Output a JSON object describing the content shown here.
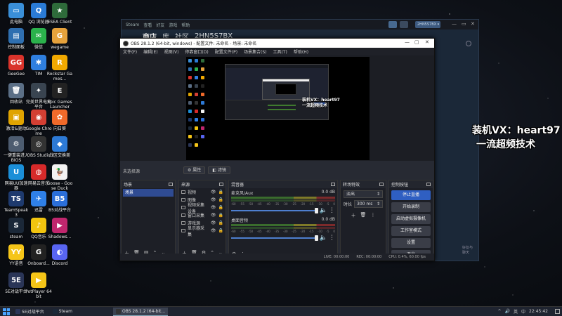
{
  "desktop": {
    "icons": [
      {
        "label": "此电脑",
        "color": "#3a8fd8",
        "glyph": "▭"
      },
      {
        "label": "QQ 浏览器",
        "color": "#2a7bd6",
        "glyph": "Q"
      },
      {
        "label": "ESEA Client",
        "color": "#2e6b3a",
        "glyph": "★"
      },
      {
        "label": "控制面板",
        "color": "#2f6fb0",
        "glyph": "▤"
      },
      {
        "label": "微信",
        "color": "#2bb24c",
        "glyph": "✉"
      },
      {
        "label": "wegame",
        "color": "#e6a23c",
        "glyph": "G"
      },
      {
        "label": "GeeGee",
        "color": "#d9332b",
        "glyph": "GG"
      },
      {
        "label": "TIM",
        "color": "#2f7fe0",
        "glyph": "✱"
      },
      {
        "label": "Rockstar Games...",
        "color": "#f2a900",
        "glyph": "R"
      },
      {
        "label": "回收站",
        "color": "#5b6f86",
        "glyph": "🗑"
      },
      {
        "label": "完美世界电竞平台",
        "color": "#394450",
        "glyph": "✦"
      },
      {
        "label": "Epic Games Launcher",
        "color": "#222",
        "glyph": "E"
      },
      {
        "label": "激活&驱动",
        "color": "#e0a400",
        "glyph": "▣"
      },
      {
        "label": "Google Chrome",
        "color": "#d33f33",
        "glyph": "◉"
      },
      {
        "label": "向日葵",
        "color": "#f06a2a",
        "glyph": "✿"
      },
      {
        "label": "一键重装进入BIOS",
        "color": "#4d5c70",
        "glyph": "⚙"
      },
      {
        "label": "OBS Studio",
        "color": "#333",
        "glyph": "◎"
      },
      {
        "label": "战区交换美",
        "color": "#2d7ad6",
        "glyph": "◆"
      },
      {
        "label": "网易UU加速器",
        "color": "#1b8fd8",
        "glyph": "U"
      },
      {
        "label": "网易云音乐",
        "color": "#d72a2a",
        "glyph": "◍"
      },
      {
        "label": "Goose - Goose Duck",
        "color": "#f2f2f2",
        "glyph": "🦆"
      },
      {
        "label": "TeamSpeak 3",
        "color": "#1e3a6e",
        "glyph": "TS"
      },
      {
        "label": "迅雷",
        "color": "#2f80e8",
        "glyph": "✈"
      },
      {
        "label": "B5对战平台",
        "color": "#2b6fd9",
        "glyph": "B5"
      },
      {
        "label": "steam",
        "color": "#1b2838",
        "glyph": "S"
      },
      {
        "label": "QQ音乐",
        "color": "#f1c40f",
        "glyph": "♪"
      },
      {
        "label": "Shadows...",
        "color": "#c0266d",
        "glyph": "▶"
      },
      {
        "label": "YY语音",
        "color": "#f5c518",
        "glyph": "YY"
      },
      {
        "label": "Onboard...",
        "color": "#222",
        "glyph": "G"
      },
      {
        "label": "Discord",
        "color": "#5865f2",
        "glyph": "◐"
      },
      {
        "label": "5E对战平台",
        "color": "#2a3557",
        "glyph": "5E"
      },
      {
        "label": "PotPlayer 64 bit",
        "color": "#f5c518",
        "glyph": "▶"
      }
    ]
  },
  "steam": {
    "menu": [
      "Steam",
      "查看",
      "好友",
      "游戏",
      "帮助"
    ],
    "nav": [
      "商店",
      "库",
      "社区",
      "2HN5S7BX"
    ],
    "user": "2HN5S7BX ▾",
    "footer": [
      "好友与",
      "聊天"
    ]
  },
  "obs": {
    "title": "OBS 28.1.2 (64-bit, windows) - 配置文件: 未命名 - 场景: 未命名",
    "menu": [
      "文件(F)",
      "编辑(E)",
      "视图(V)",
      "停靠窗口(D)",
      "配置文件(P)",
      "场景集合(S)",
      "工具(T)",
      "帮助(H)"
    ],
    "preview_overlay": [
      "装机VX：heart97",
      "一流超频技术"
    ],
    "no_source": "未选择源",
    "props_btn": "⚙ 属性",
    "filters_btn": "◧ 滤镜",
    "docks": {
      "scenes": {
        "title": "场景",
        "items": [
          "场景"
        ]
      },
      "sources": {
        "title": "来源",
        "items": [
          "视频",
          "图像",
          "视频采集设备",
          "窗口采集",
          "游戏源",
          "显示器采集"
        ]
      },
      "mixer": {
        "title": "混音器",
        "tracks": [
          {
            "name": "麦克风/Aux",
            "db": "0.0 dB"
          },
          {
            "name": "桌面音频",
            "db": "0.0 dB"
          }
        ],
        "scale": [
          "-60",
          "-55",
          "-50",
          "-45",
          "-40",
          "-35",
          "-30",
          "-25",
          "-20",
          "-15",
          "-10",
          "-5",
          "0"
        ]
      },
      "transitions": {
        "title": "转场特效",
        "type": "淡出",
        "duration_label": "时长",
        "duration": "300 ms"
      },
      "controls": {
        "title": "控制按钮",
        "buttons": [
          "停止直播",
          "开始录制",
          "启动虚拟摄像机",
          "工作室模式",
          "设置",
          "退出"
        ]
      }
    },
    "status": {
      "live": "LIVE: 00:00:00",
      "rec": "REC: 00:00:00",
      "cpu": "CPU: 0.4%, 60.00 fps"
    }
  },
  "overlay_big": [
    "装机VX：heart97",
    "一流超频技术"
  ],
  "taskbar": {
    "items": [
      {
        "label": "5E对战平台",
        "color": "#2a3557"
      },
      {
        "label": "Steam",
        "color": "#1b2838"
      },
      {
        "label": "OBS 28.1.2 (64-bit...",
        "color": "#333"
      }
    ],
    "tray": [
      "^",
      "🔊",
      "英",
      "中"
    ],
    "clock": "22:45:42"
  }
}
